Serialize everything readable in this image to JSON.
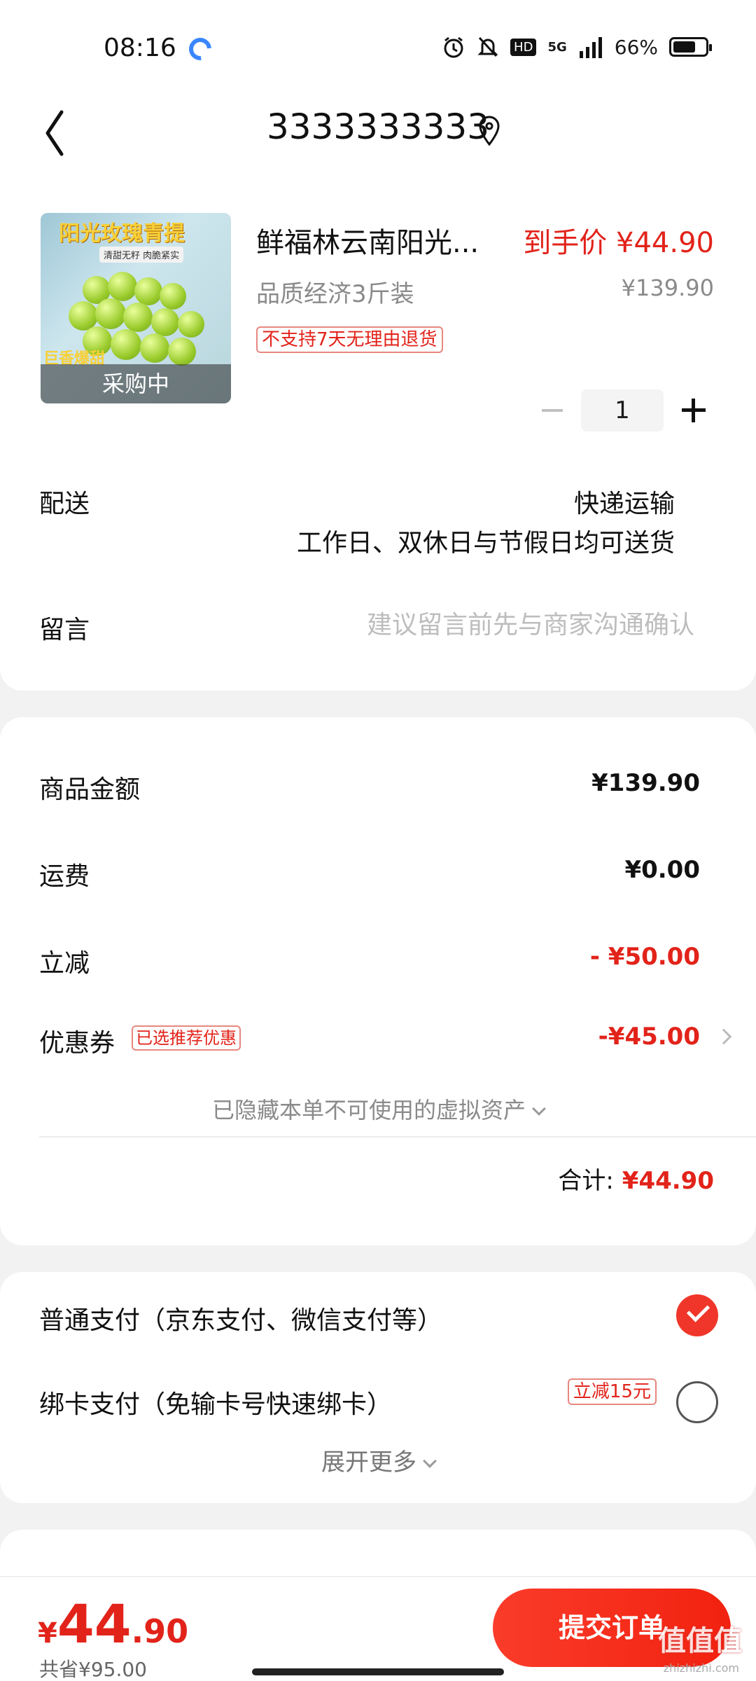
{
  "status_bar": {
    "time": "08:16",
    "battery": "66%",
    "network": "5G",
    "hd": "HD"
  },
  "nav": {
    "title": "3333333333"
  },
  "product": {
    "name": "鲜福林云南阳光...",
    "final_price": "到手价 ¥44.90",
    "spec": "品质经济3斤装",
    "original_price": "¥139.90",
    "return_policy": "不支持7天无理由退货",
    "image_banner": "阳光玫瑰青提",
    "image_sub": "清甜无籽 肉脆紧实",
    "image_promo": "巨香爆甜",
    "image_overlay": "采购中",
    "quantity": "1"
  },
  "delivery": {
    "label": "配送",
    "method": "快递运输",
    "time": "工作日、双休日与节假日均可送货"
  },
  "message": {
    "label": "留言",
    "placeholder": "建议留言前先与商家沟通确认"
  },
  "summary": {
    "goods_label": "商品金额",
    "goods_value": "¥139.90",
    "shipping_label": "运费",
    "shipping_value": "¥0.00",
    "discount_label": "立减",
    "discount_value": "- ¥50.00",
    "coupon_label": "优惠券",
    "coupon_tag": "已选推荐优惠",
    "coupon_value": "-¥45.00",
    "hidden_assets": "已隐藏本单不可使用的虚拟资产",
    "total_label": "合计:",
    "total_value": "¥44.90"
  },
  "payment": {
    "normal_label": "普通支付（京东支付、微信支付等）",
    "bind_label": "绑卡支付（免输卡号快速绑卡）",
    "bind_tag": "立减15元",
    "expand_more": "展开更多",
    "selected": "normal"
  },
  "bottom": {
    "currency": "¥",
    "price_int": "44",
    "price_dec": ".90",
    "saved": "共省¥95.00",
    "submit_label": "提交订单",
    "watermark": "值值值",
    "watermark_sub": "zhizhizhi.com"
  },
  "colors": {
    "accent": "#e2231a",
    "submit": "#f2210f"
  }
}
